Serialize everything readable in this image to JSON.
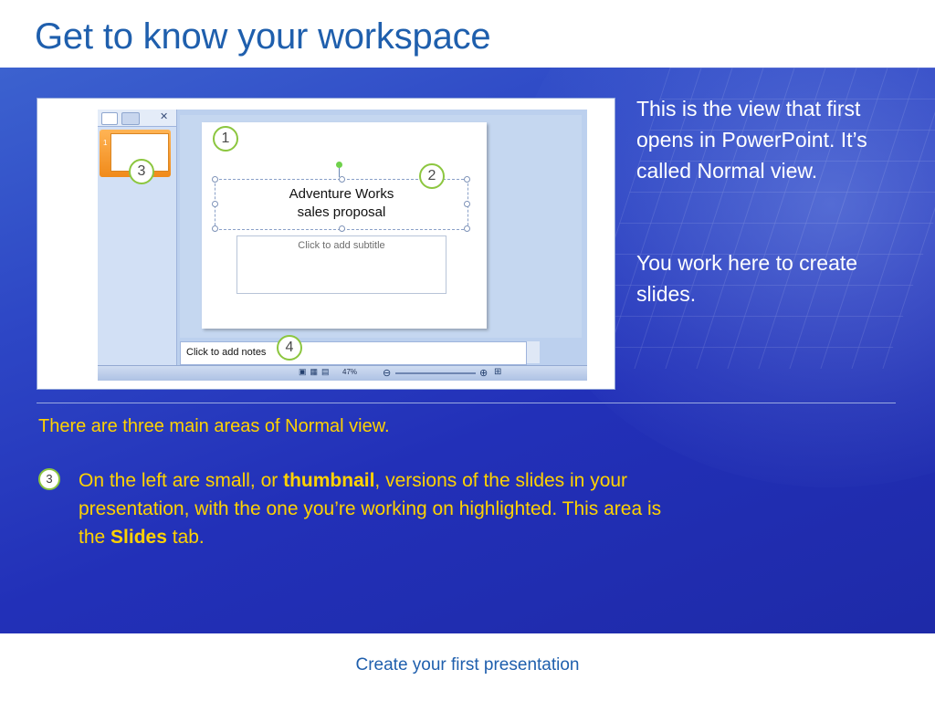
{
  "slide": {
    "title": "Get to know your workspace",
    "footer": "Create your first presentation"
  },
  "screenshot": {
    "slide_title_line1": "Adventure Works",
    "slide_title_line2": "sales proposal",
    "subtitle_placeholder": "Click to add subtitle",
    "notes_placeholder": "Click to add notes",
    "zoom_level": "47%",
    "thumbnail_number": "1",
    "callouts": [
      "1",
      "2",
      "3",
      "4"
    ]
  },
  "right_panel": {
    "para1": "This is the view that first opens in PowerPoint. It’s called Normal view.",
    "para2": "You work here to create slides."
  },
  "body": {
    "summary": "There are three main areas of Normal view.",
    "bullet_number": "3",
    "bullet_part1": "On the left are small, or ",
    "bullet_bold1": "thumbnail",
    "bullet_part2": ", versions of the slides in your presentation, with the one you’re working on highlighted. This area is the ",
    "bullet_bold2": "Slides",
    "bullet_part3": " tab."
  },
  "colors": {
    "title_blue": "#1f5fad",
    "panel_blue": "#2230b8",
    "highlight_yellow": "#ffd200",
    "callout_green": "#8cc63f"
  }
}
